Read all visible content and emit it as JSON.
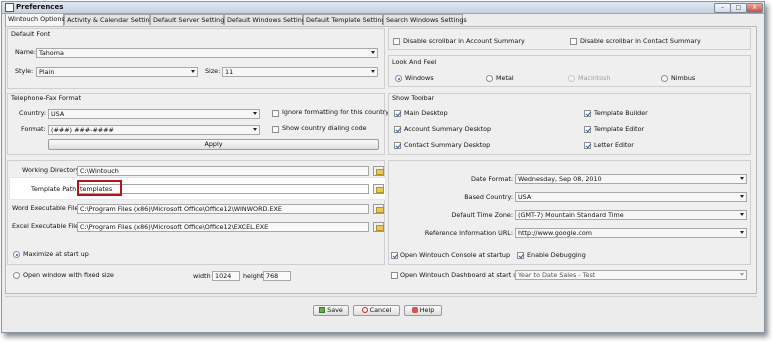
{
  "window": {
    "title": "Preferences",
    "min": "–",
    "max": "□",
    "close": "X"
  },
  "tabs": [
    "Wintouch Options",
    "Activity & Calendar Settings",
    "Default Server Settings",
    "Default Windows Settings",
    "Default Template Settings",
    "Search Windows Settings"
  ],
  "default_font": {
    "title": "Default Font",
    "name_label": "Name:",
    "name_value": "Tahoma",
    "style_label": "Style:",
    "style_value": "Plain",
    "size_label": "Size:",
    "size_value": "11"
  },
  "phone_format": {
    "title": "Telephone-Fax Format",
    "country_label": "Country:",
    "country_value": "USA",
    "format_label": "Format:",
    "format_value": "(###) ###-####",
    "ignore_label": "Ignore formatting for this country",
    "show_code_label": "Show country dialing code",
    "apply_label": "Apply"
  },
  "scrollbars": {
    "account": "Disable scrollbar in Account Summary",
    "contact": "Disable scrollbar in Contact Summary"
  },
  "look_feel": {
    "title": "Look And Feel",
    "options": [
      "Windows",
      "Metal",
      "Macintosh",
      "Nimbus"
    ],
    "selected": "Windows"
  },
  "toolbar": {
    "title": "Show Toolbar",
    "items": [
      "Main Desktop",
      "Account Summary Desktop",
      "Contact Summary Desktop",
      "Template Builder",
      "Template Editor",
      "Letter Editor"
    ]
  },
  "paths": {
    "working_label": "Working Directory:",
    "working_value": "C:\\Wintouch",
    "template_label": "Template Path:",
    "template_value": "templates",
    "word_label": "Word Executable File:",
    "word_value": "C:\\Program Files (x86)\\Microsoft Office\\Office12\\WINWORD.EXE",
    "excel_label": "Excel Executable File:",
    "excel_value": "C:\\Program Files (x86)\\Microsoft Office\\Office12\\EXCEL.EXE"
  },
  "right_fields": {
    "date_label": "Date Format:",
    "date_value": "Wednesday, Sep 08, 2010",
    "country_label": "Based Country:",
    "country_value": "USA",
    "tz_label": "Default Time Zone:",
    "tz_value": "(GMT-7) Mountain Standard Time",
    "url_label": "Reference Information URL:",
    "url_value": "http://www.google.com"
  },
  "startup": {
    "maximize": "Maximize at start up",
    "fixed": "Open window with fixed size",
    "width_label": "width",
    "width_value": "1024",
    "height_label": "height",
    "height_value": "768",
    "console": "Open Wintouch Console at startup",
    "debugging": "Enable Debugging",
    "dashboard": "Open Wintouch Dashboard at start up",
    "dashboard_value": "Year to Date Sales - Test"
  },
  "buttons": {
    "save": "Save",
    "cancel": "Cancel",
    "help": "Help"
  },
  "colors": {
    "highlight_border": "#b3141a",
    "accent": "#2d62b8"
  }
}
